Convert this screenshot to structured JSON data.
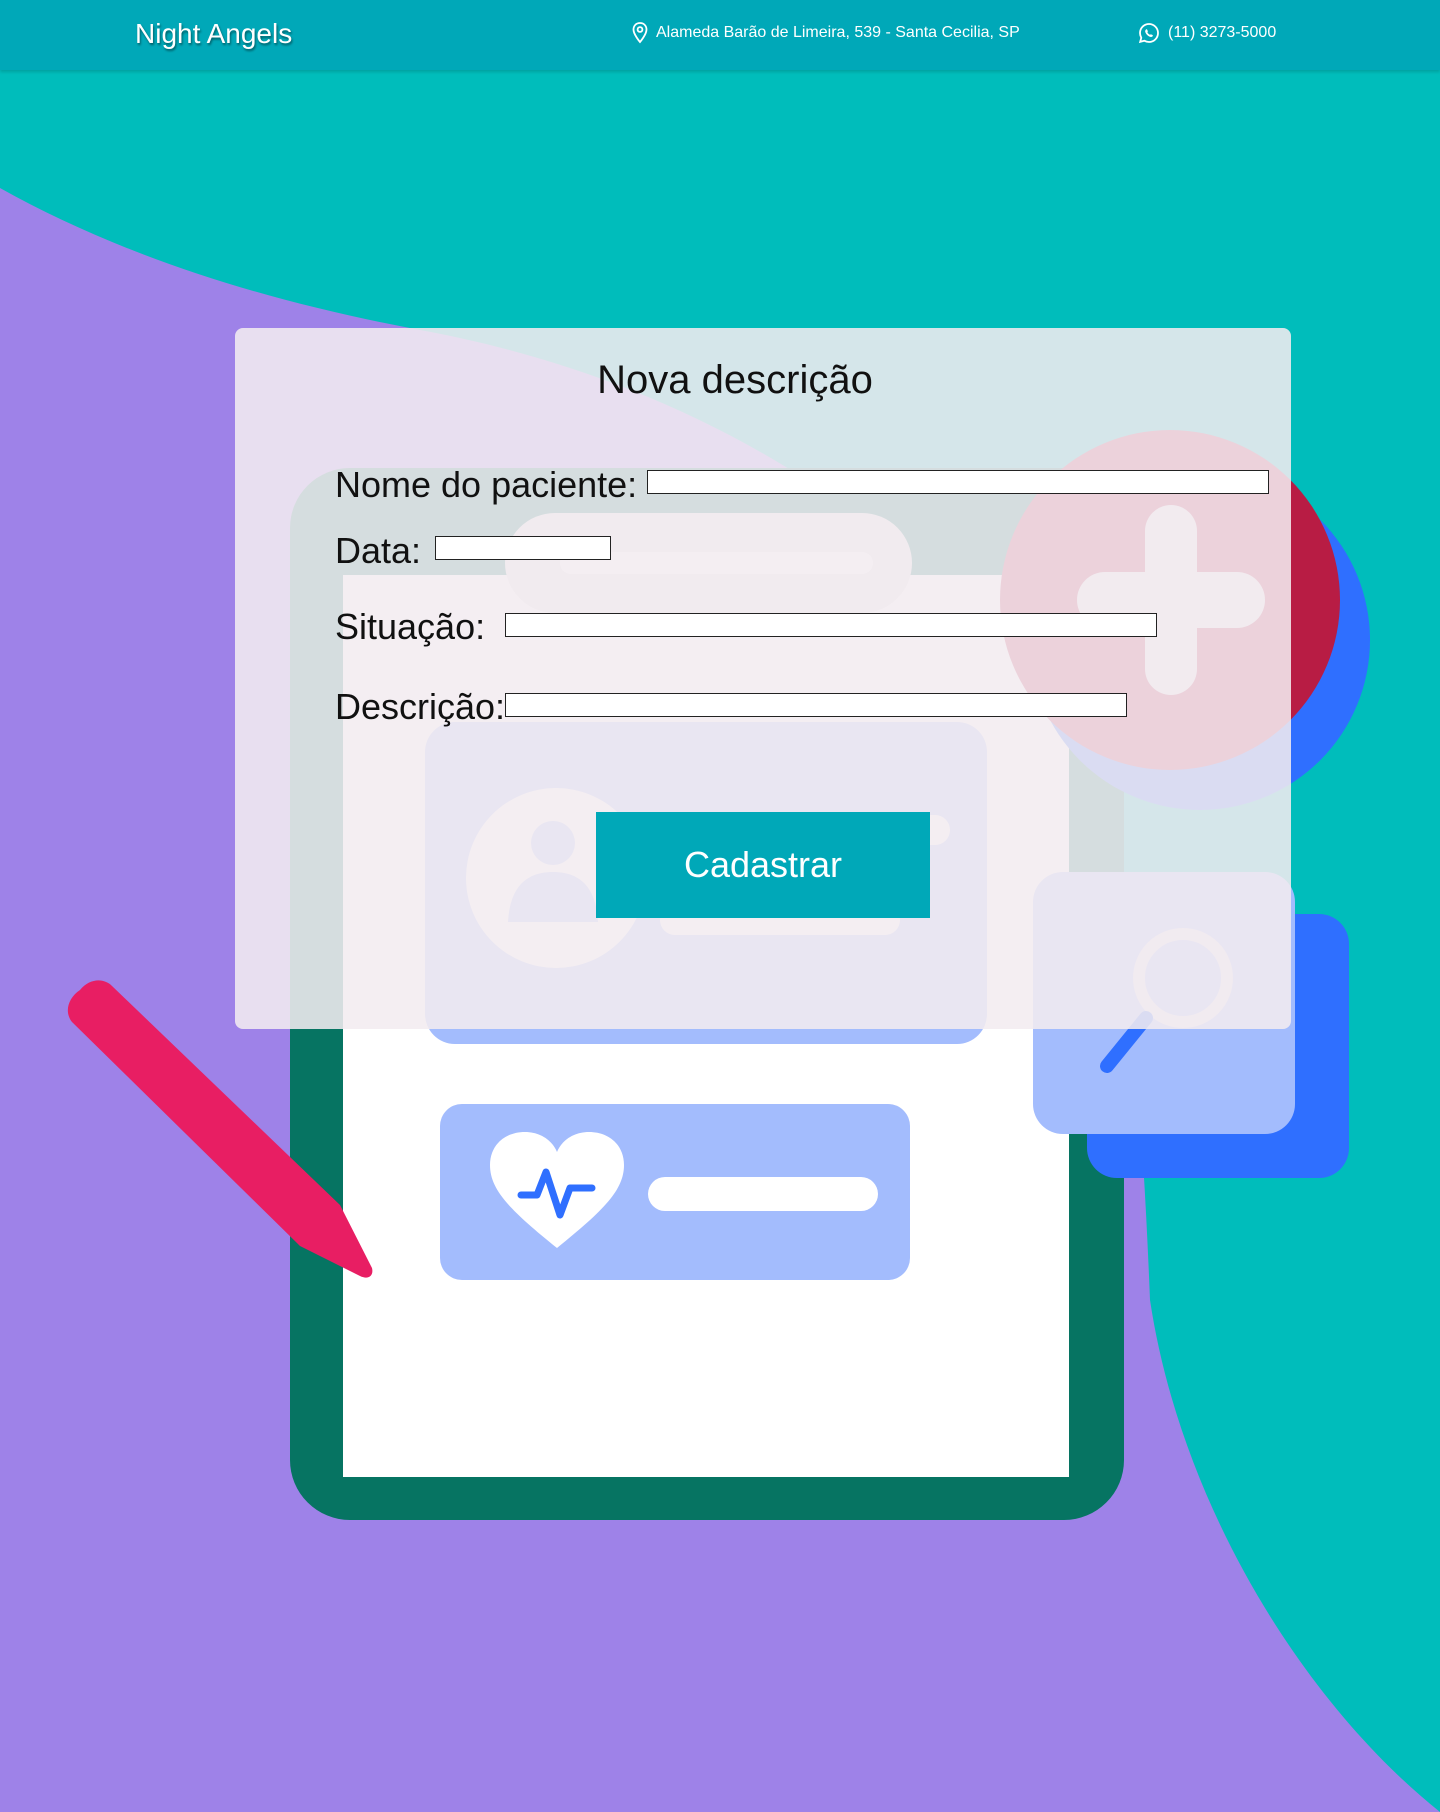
{
  "header": {
    "brand": "Night Angels",
    "address": "Alameda Barão de Limeira, 539 - Santa Cecilia, SP",
    "phone": "(11) 3273-5000",
    "address_icon": "map-pin-icon",
    "phone_icon": "whatsapp-icon",
    "bar_color": "#00a8b8"
  },
  "form": {
    "title": "Nova descrição",
    "fields": {
      "patient_name": {
        "label": "Nome do paciente:",
        "value": ""
      },
      "date": {
        "label": "Data:",
        "value": ""
      },
      "status": {
        "label": "Situação:",
        "value": ""
      },
      "description": {
        "label": "Descrição:",
        "value": ""
      }
    },
    "submit_label": "Cadastrar"
  },
  "colors": {
    "background_teal": "#00bdbb",
    "background_purple": "#9e82e8",
    "clipboard_green": "#067462",
    "accent_pink": "#e81e63",
    "accent_blue": "#2f6fff"
  }
}
